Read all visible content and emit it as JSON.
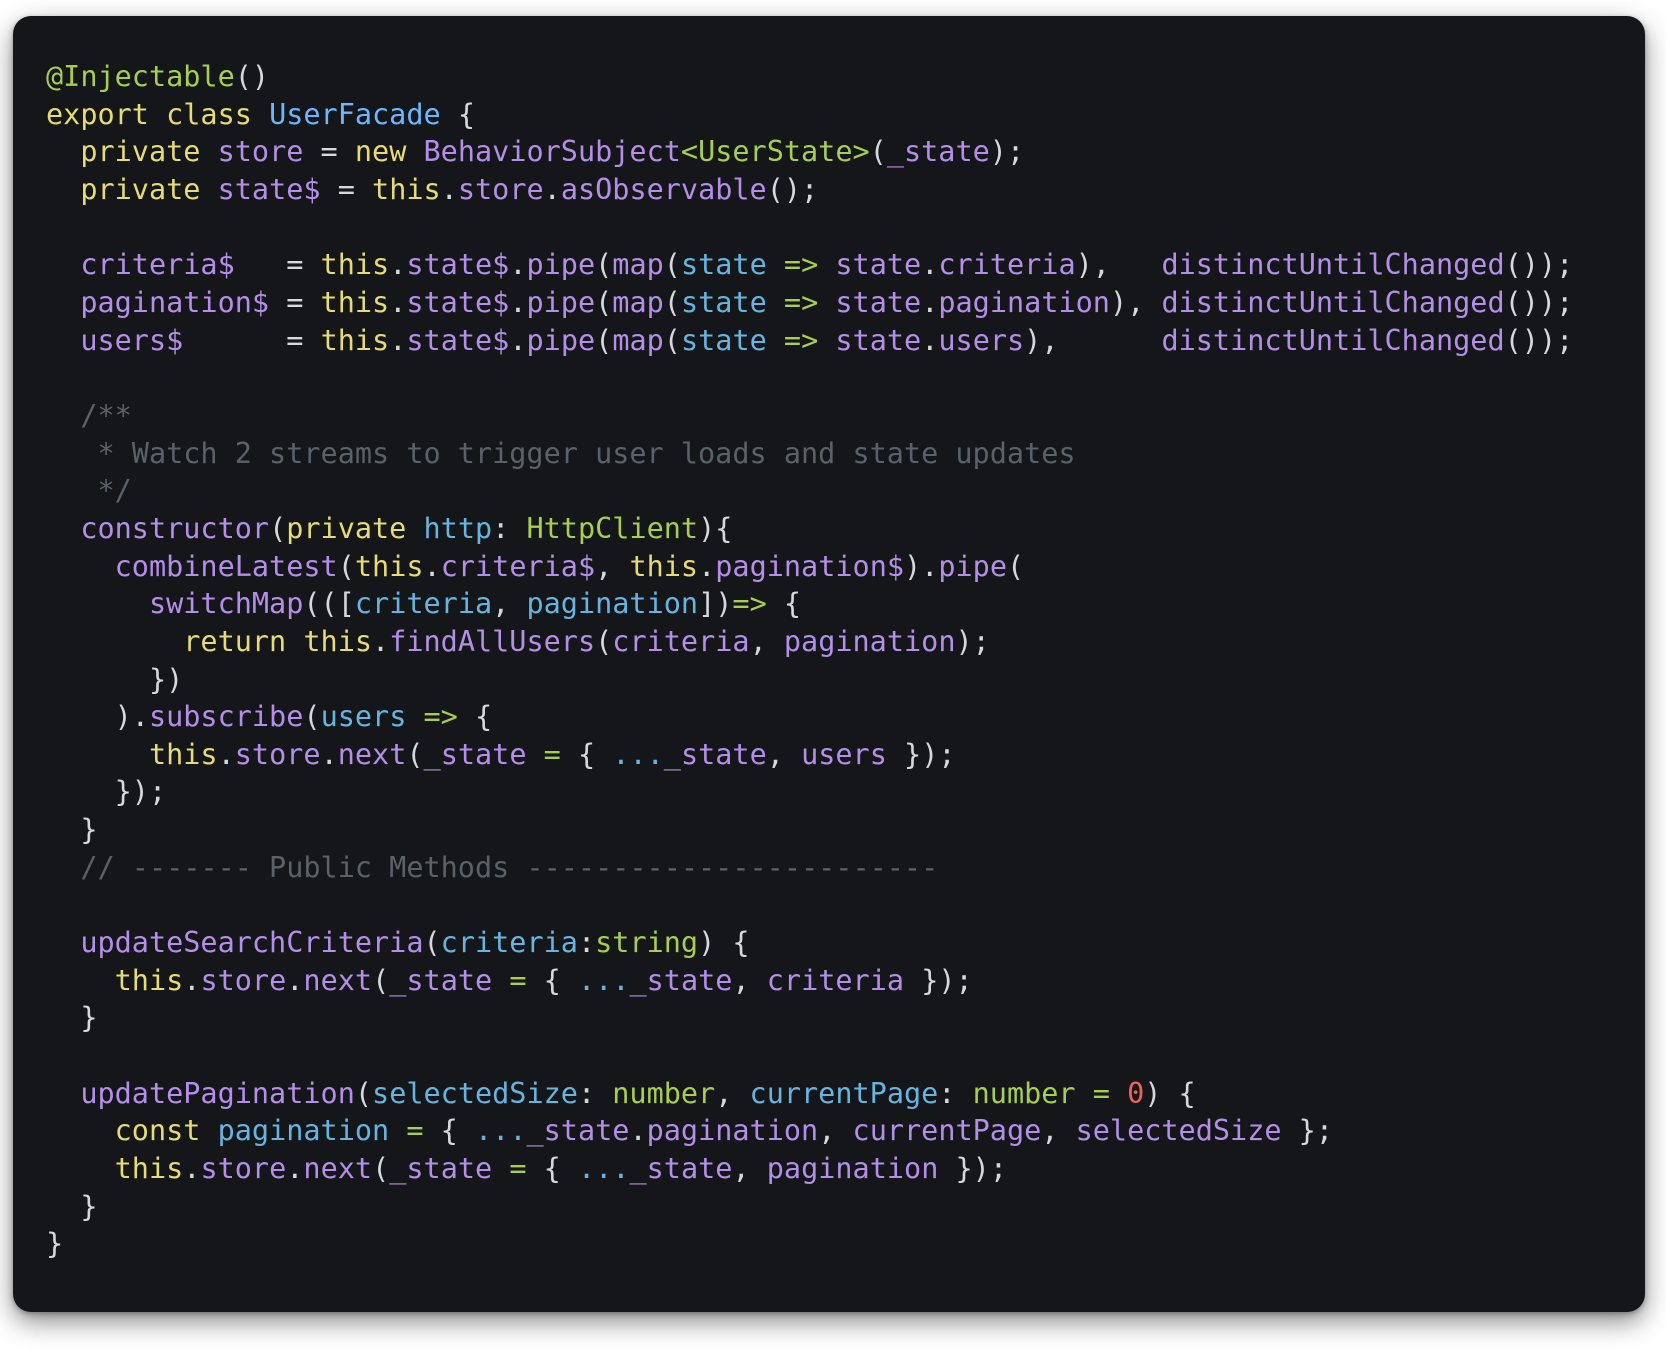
{
  "language": "typescript",
  "theme": {
    "background": "#151619",
    "keyword": "#e6db74",
    "decorator": "#a6cf4f",
    "type": "#6cb6ff",
    "property": "#b48ee8",
    "variable": "#66b5e0",
    "number": "#f0605a",
    "comment": "#5a6168",
    "punctuation": "#d5d8dc"
  },
  "code": {
    "lines": [
      [
        {
          "t": "@Injectable",
          "c": "dec"
        },
        {
          "t": "()",
          "c": "pun"
        }
      ],
      [
        {
          "t": "export class ",
          "c": "kw"
        },
        {
          "t": "UserFacade",
          "c": "type"
        },
        {
          "t": " {",
          "c": "pun"
        }
      ],
      [
        {
          "t": "  private ",
          "c": "kw"
        },
        {
          "t": "store",
          "c": "prop"
        },
        {
          "t": " = ",
          "c": "pun"
        },
        {
          "t": "new ",
          "c": "kw"
        },
        {
          "t": "BehaviorSubject",
          "c": "fn"
        },
        {
          "t": "<UserState>",
          "c": "gen"
        },
        {
          "t": "(",
          "c": "pun"
        },
        {
          "t": "_state",
          "c": "prop"
        },
        {
          "t": ");",
          "c": "pun"
        }
      ],
      [
        {
          "t": "  private ",
          "c": "kw"
        },
        {
          "t": "state$",
          "c": "prop"
        },
        {
          "t": " = ",
          "c": "pun"
        },
        {
          "t": "this",
          "c": "kw"
        },
        {
          "t": ".",
          "c": "pun"
        },
        {
          "t": "store",
          "c": "prop"
        },
        {
          "t": ".",
          "c": "pun"
        },
        {
          "t": "asObservable",
          "c": "fn"
        },
        {
          "t": "();",
          "c": "pun"
        }
      ],
      [],
      [
        {
          "t": "  criteria$",
          "c": "prop"
        },
        {
          "t": "   = ",
          "c": "pun"
        },
        {
          "t": "this",
          "c": "kw"
        },
        {
          "t": ".",
          "c": "pun"
        },
        {
          "t": "state$",
          "c": "prop"
        },
        {
          "t": ".",
          "c": "pun"
        },
        {
          "t": "pipe",
          "c": "fn"
        },
        {
          "t": "(",
          "c": "pun"
        },
        {
          "t": "map",
          "c": "fn"
        },
        {
          "t": "(",
          "c": "pun"
        },
        {
          "t": "state",
          "c": "var"
        },
        {
          "t": " => ",
          "c": "arrow"
        },
        {
          "t": "state",
          "c": "prop"
        },
        {
          "t": ".",
          "c": "pun"
        },
        {
          "t": "criteria",
          "c": "prop"
        },
        {
          "t": "),   ",
          "c": "pun"
        },
        {
          "t": "distinctUntilChanged",
          "c": "fn"
        },
        {
          "t": "());",
          "c": "pun"
        }
      ],
      [
        {
          "t": "  pagination$",
          "c": "prop"
        },
        {
          "t": " = ",
          "c": "pun"
        },
        {
          "t": "this",
          "c": "kw"
        },
        {
          "t": ".",
          "c": "pun"
        },
        {
          "t": "state$",
          "c": "prop"
        },
        {
          "t": ".",
          "c": "pun"
        },
        {
          "t": "pipe",
          "c": "fn"
        },
        {
          "t": "(",
          "c": "pun"
        },
        {
          "t": "map",
          "c": "fn"
        },
        {
          "t": "(",
          "c": "pun"
        },
        {
          "t": "state",
          "c": "var"
        },
        {
          "t": " => ",
          "c": "arrow"
        },
        {
          "t": "state",
          "c": "prop"
        },
        {
          "t": ".",
          "c": "pun"
        },
        {
          "t": "pagination",
          "c": "prop"
        },
        {
          "t": "), ",
          "c": "pun"
        },
        {
          "t": "distinctUntilChanged",
          "c": "fn"
        },
        {
          "t": "());",
          "c": "pun"
        }
      ],
      [
        {
          "t": "  users$",
          "c": "prop"
        },
        {
          "t": "      = ",
          "c": "pun"
        },
        {
          "t": "this",
          "c": "kw"
        },
        {
          "t": ".",
          "c": "pun"
        },
        {
          "t": "state$",
          "c": "prop"
        },
        {
          "t": ".",
          "c": "pun"
        },
        {
          "t": "pipe",
          "c": "fn"
        },
        {
          "t": "(",
          "c": "pun"
        },
        {
          "t": "map",
          "c": "fn"
        },
        {
          "t": "(",
          "c": "pun"
        },
        {
          "t": "state",
          "c": "var"
        },
        {
          "t": " => ",
          "c": "arrow"
        },
        {
          "t": "state",
          "c": "prop"
        },
        {
          "t": ".",
          "c": "pun"
        },
        {
          "t": "users",
          "c": "prop"
        },
        {
          "t": "),      ",
          "c": "pun"
        },
        {
          "t": "distinctUntilChanged",
          "c": "fn"
        },
        {
          "t": "());",
          "c": "pun"
        }
      ],
      [],
      [
        {
          "t": "  /**",
          "c": "com"
        }
      ],
      [
        {
          "t": "   * Watch 2 streams to trigger user loads and state updates",
          "c": "com"
        }
      ],
      [
        {
          "t": "   */",
          "c": "com"
        }
      ],
      [
        {
          "t": "  constructor",
          "c": "fn"
        },
        {
          "t": "(",
          "c": "pun"
        },
        {
          "t": "private ",
          "c": "kw"
        },
        {
          "t": "http",
          "c": "var"
        },
        {
          "t": ": ",
          "c": "pun"
        },
        {
          "t": "HttpClient",
          "c": "dec"
        },
        {
          "t": "){",
          "c": "pun"
        }
      ],
      [
        {
          "t": "    combineLatest",
          "c": "fn"
        },
        {
          "t": "(",
          "c": "pun"
        },
        {
          "t": "this",
          "c": "kw"
        },
        {
          "t": ".",
          "c": "pun"
        },
        {
          "t": "criteria$",
          "c": "prop"
        },
        {
          "t": ", ",
          "c": "pun"
        },
        {
          "t": "this",
          "c": "kw"
        },
        {
          "t": ".",
          "c": "pun"
        },
        {
          "t": "pagination$",
          "c": "prop"
        },
        {
          "t": ").",
          "c": "pun"
        },
        {
          "t": "pipe",
          "c": "fn"
        },
        {
          "t": "(",
          "c": "pun"
        }
      ],
      [
        {
          "t": "      switchMap",
          "c": "fn"
        },
        {
          "t": "(([",
          "c": "pun"
        },
        {
          "t": "criteria",
          "c": "var"
        },
        {
          "t": ", ",
          "c": "pun"
        },
        {
          "t": "pagination",
          "c": "var"
        },
        {
          "t": "])",
          "c": "pun"
        },
        {
          "t": "=> ",
          "c": "arrow"
        },
        {
          "t": "{",
          "c": "pun"
        }
      ],
      [
        {
          "t": "        return ",
          "c": "kw"
        },
        {
          "t": "this",
          "c": "kw"
        },
        {
          "t": ".",
          "c": "pun"
        },
        {
          "t": "findAllUsers",
          "c": "fn"
        },
        {
          "t": "(",
          "c": "pun"
        },
        {
          "t": "criteria",
          "c": "prop"
        },
        {
          "t": ", ",
          "c": "pun"
        },
        {
          "t": "pagination",
          "c": "prop"
        },
        {
          "t": ");",
          "c": "pun"
        }
      ],
      [
        {
          "t": "      })",
          "c": "pun"
        }
      ],
      [
        {
          "t": "    ).",
          "c": "pun"
        },
        {
          "t": "subscribe",
          "c": "fn"
        },
        {
          "t": "(",
          "c": "pun"
        },
        {
          "t": "users",
          "c": "var"
        },
        {
          "t": " => ",
          "c": "arrow"
        },
        {
          "t": "{",
          "c": "pun"
        }
      ],
      [
        {
          "t": "      this",
          "c": "kw"
        },
        {
          "t": ".",
          "c": "pun"
        },
        {
          "t": "store",
          "c": "prop"
        },
        {
          "t": ".",
          "c": "pun"
        },
        {
          "t": "next",
          "c": "fn"
        },
        {
          "t": "(",
          "c": "pun"
        },
        {
          "t": "_state",
          "c": "prop"
        },
        {
          "t": " = ",
          "c": "arrow"
        },
        {
          "t": "{ ",
          "c": "pun"
        },
        {
          "t": "...",
          "c": "var"
        },
        {
          "t": "_state",
          "c": "prop"
        },
        {
          "t": ", ",
          "c": "pun"
        },
        {
          "t": "users",
          "c": "prop"
        },
        {
          "t": " });",
          "c": "pun"
        }
      ],
      [
        {
          "t": "    });",
          "c": "pun"
        }
      ],
      [
        {
          "t": "  }",
          "c": "pun"
        }
      ],
      [
        {
          "t": "  // ------- Public Methods ------------------------",
          "c": "com"
        }
      ],
      [],
      [
        {
          "t": "  updateSearchCriteria",
          "c": "fn"
        },
        {
          "t": "(",
          "c": "pun"
        },
        {
          "t": "criteria",
          "c": "var"
        },
        {
          "t": ":",
          "c": "pun"
        },
        {
          "t": "string",
          "c": "dec"
        },
        {
          "t": ") {",
          "c": "pun"
        }
      ],
      [
        {
          "t": "    this",
          "c": "kw"
        },
        {
          "t": ".",
          "c": "pun"
        },
        {
          "t": "store",
          "c": "prop"
        },
        {
          "t": ".",
          "c": "pun"
        },
        {
          "t": "next",
          "c": "fn"
        },
        {
          "t": "(",
          "c": "pun"
        },
        {
          "t": "_state",
          "c": "prop"
        },
        {
          "t": " = ",
          "c": "arrow"
        },
        {
          "t": "{ ",
          "c": "pun"
        },
        {
          "t": "...",
          "c": "var"
        },
        {
          "t": "_state",
          "c": "prop"
        },
        {
          "t": ", ",
          "c": "pun"
        },
        {
          "t": "criteria",
          "c": "prop"
        },
        {
          "t": " });",
          "c": "pun"
        }
      ],
      [
        {
          "t": "  }",
          "c": "pun"
        }
      ],
      [],
      [
        {
          "t": "  updatePagination",
          "c": "fn"
        },
        {
          "t": "(",
          "c": "pun"
        },
        {
          "t": "selectedSize",
          "c": "var"
        },
        {
          "t": ": ",
          "c": "pun"
        },
        {
          "t": "number",
          "c": "dec"
        },
        {
          "t": ", ",
          "c": "pun"
        },
        {
          "t": "currentPage",
          "c": "var"
        },
        {
          "t": ": ",
          "c": "pun"
        },
        {
          "t": "number",
          "c": "dec"
        },
        {
          "t": " = ",
          "c": "arrow"
        },
        {
          "t": "0",
          "c": "num"
        },
        {
          "t": ") {",
          "c": "pun"
        }
      ],
      [
        {
          "t": "    const ",
          "c": "kw"
        },
        {
          "t": "pagination",
          "c": "var"
        },
        {
          "t": " = ",
          "c": "arrow"
        },
        {
          "t": "{ ",
          "c": "pun"
        },
        {
          "t": "...",
          "c": "var"
        },
        {
          "t": "_state",
          "c": "prop"
        },
        {
          "t": ".",
          "c": "pun"
        },
        {
          "t": "pagination",
          "c": "prop"
        },
        {
          "t": ", ",
          "c": "pun"
        },
        {
          "t": "currentPage",
          "c": "prop"
        },
        {
          "t": ", ",
          "c": "pun"
        },
        {
          "t": "selectedSize",
          "c": "prop"
        },
        {
          "t": " };",
          "c": "pun"
        }
      ],
      [
        {
          "t": "    this",
          "c": "kw"
        },
        {
          "t": ".",
          "c": "pun"
        },
        {
          "t": "store",
          "c": "prop"
        },
        {
          "t": ".",
          "c": "pun"
        },
        {
          "t": "next",
          "c": "fn"
        },
        {
          "t": "(",
          "c": "pun"
        },
        {
          "t": "_state",
          "c": "prop"
        },
        {
          "t": " = ",
          "c": "arrow"
        },
        {
          "t": "{ ",
          "c": "pun"
        },
        {
          "t": "...",
          "c": "var"
        },
        {
          "t": "_state",
          "c": "prop"
        },
        {
          "t": ", ",
          "c": "pun"
        },
        {
          "t": "pagination",
          "c": "prop"
        },
        {
          "t": " });",
          "c": "pun"
        }
      ],
      [
        {
          "t": "  }",
          "c": "pun"
        }
      ],
      [
        {
          "t": "}",
          "c": "pun"
        }
      ]
    ]
  }
}
